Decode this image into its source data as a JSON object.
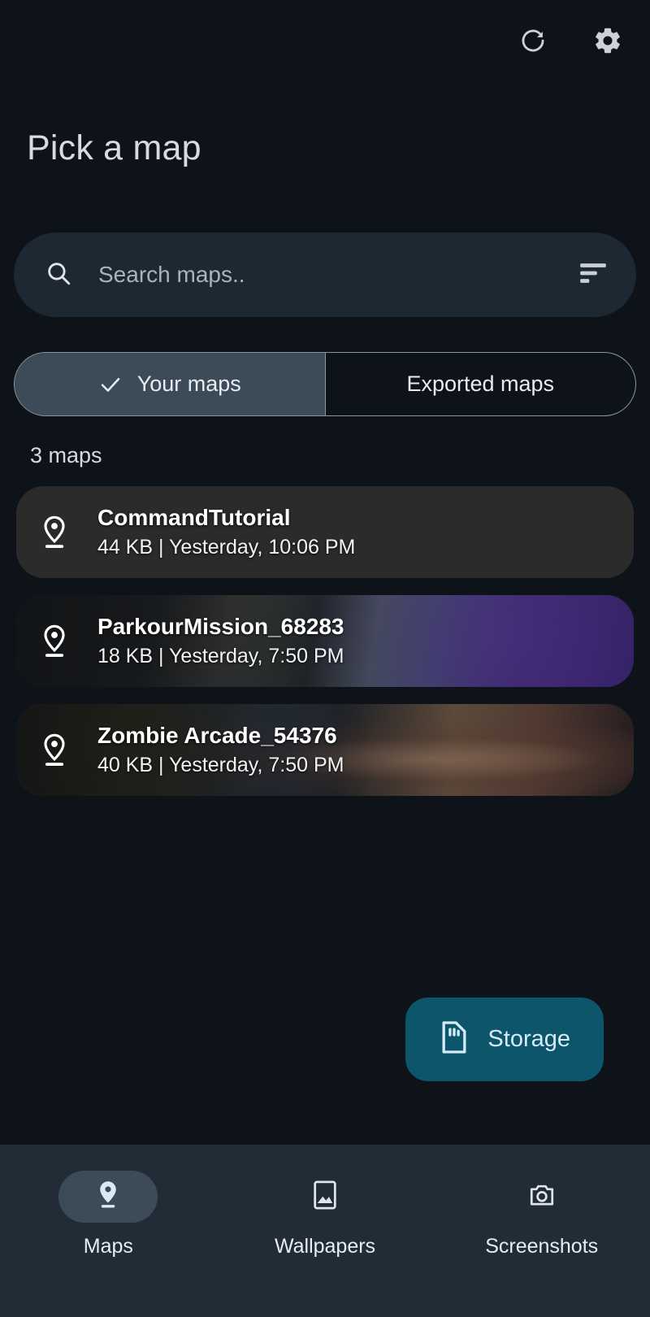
{
  "app": {
    "title": "Pick a map",
    "background_color": "#0d1318"
  },
  "topbar": {
    "refresh_icon": "refresh-icon",
    "settings_icon": "gear-icon"
  },
  "search": {
    "placeholder": "Search maps..",
    "value": "",
    "search_icon": "search-icon",
    "sort_icon": "sort-icon"
  },
  "tabs": {
    "selected_index": 0,
    "items": [
      {
        "label": "Your maps",
        "selected": true
      },
      {
        "label": "Exported maps",
        "selected": false
      }
    ],
    "check_icon": "check-icon",
    "selected_color": "#3b4b57"
  },
  "list": {
    "count_label": "3 maps",
    "items": [
      {
        "name": "CommandTutorial",
        "size": "44 KB",
        "separator": "|",
        "date": "Yesterday, 10:06 PM",
        "meta": "44 KB | Yesterday, 10:06 PM",
        "icon": "map-pin-icon",
        "has_thumbnail": false
      },
      {
        "name": "ParkourMission_68283",
        "size": "18 KB",
        "separator": "|",
        "date": "Yesterday, 7:50 PM",
        "meta": "18 KB | Yesterday, 7:50 PM",
        "icon": "map-pin-icon",
        "has_thumbnail": true
      },
      {
        "name": "Zombie Arcade_54376",
        "size": "40 KB",
        "separator": "|",
        "date": "Yesterday, 7:50 PM",
        "meta": "40 KB | Yesterday, 7:50 PM",
        "icon": "map-pin-icon",
        "has_thumbnail": true
      }
    ]
  },
  "storage_button": {
    "label": "Storage",
    "icon": "sd-card-icon",
    "background_color": "#0c556b",
    "text_color": "#d5ecf7"
  },
  "bottom_nav": {
    "active_index": 0,
    "background_color": "#222c36",
    "items": [
      {
        "label": "Maps",
        "icon": "map-pin-filled-icon",
        "active": true
      },
      {
        "label": "Wallpapers",
        "icon": "image-icon",
        "active": false
      },
      {
        "label": "Screenshots",
        "icon": "camera-icon",
        "active": false
      }
    ]
  }
}
